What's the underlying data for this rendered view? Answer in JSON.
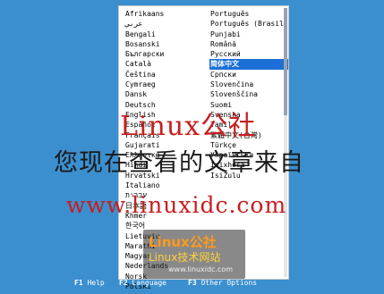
{
  "languages_left": [
    "Afrikaans",
    "عربي",
    "Bengali",
    "Bosanski",
    "Български",
    "Català",
    "Čeština",
    "Cymraeg",
    "Dansk",
    "Deutsch",
    "English",
    "Español",
    "Français",
    "Gujarati",
    "Ελληνικά",
    "Hindi",
    "Hrvatski",
    "Italiano",
    "עברית",
    "日本語",
    "Khmer",
    "한국어",
    "Lietuvių",
    "Marathi",
    "Magyar",
    "Nederlands",
    "Norsk",
    "Polski"
  ],
  "languages_right": [
    "Português",
    "Português (Brasil)",
    "Punjabi",
    "Română",
    "Русский",
    "简体中文",
    "Српски",
    "Slovenčina",
    "Slovenščina",
    "Suomi",
    "Svenska",
    "Tamil",
    "繁體中文(台灣)",
    "Türkçe",
    "Українська",
    "Isixhosa",
    "IsiZulu"
  ],
  "selected_language": "简体中文",
  "fkeys": {
    "help": {
      "key": "F1",
      "label": "Help"
    },
    "language": {
      "key": "F2",
      "label": "Language"
    },
    "other_options": {
      "key": "F3",
      "label": "Other Options"
    }
  },
  "watermark": {
    "line1": "Linux公社",
    "line2": "您现在查看的文章来自",
    "line3": "www.linuxidc.com"
  },
  "logo": {
    "top": "Linux公社",
    "middle": "Linux技术网站",
    "url": "www.linuxidc.com"
  },
  "colors": {
    "background": "#3b8fcf",
    "selection": "#1c6fd6"
  }
}
